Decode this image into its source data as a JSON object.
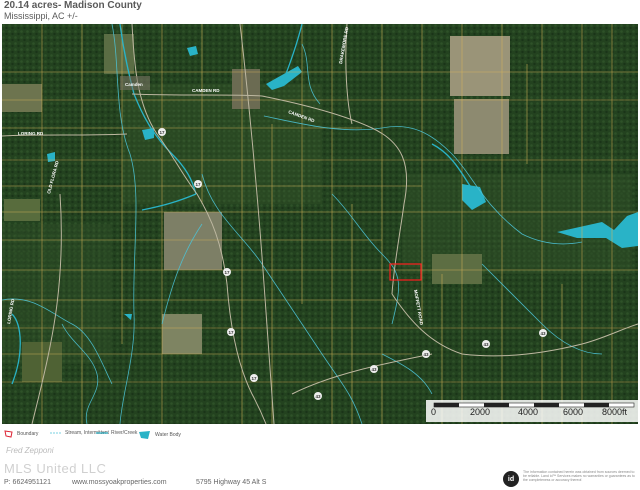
{
  "header": {
    "title": "20.14 acres- Madison County",
    "subtitle": "Mississippi, AC +/-"
  },
  "map": {
    "town_label": "Camden",
    "road_labels": [
      "CAMDEN RD",
      "LORING RD",
      "CAMDEN RD",
      "OLD FLORA RD",
      "DRAKEMORE RD",
      "LORING RD",
      "MOFFETT ROAD"
    ],
    "highway_shields": [
      "17",
      "17",
      "17",
      "17",
      "17",
      "43",
      "43",
      "43",
      "43",
      "43"
    ],
    "scale_ticks": [
      "0",
      "2000",
      "4000",
      "6000",
      "8000ft"
    ],
    "colors": {
      "boundary": "#ff2020",
      "parcel_lines": "#d9b65a",
      "water": "#29b3c7",
      "streams": "#4cc3d6",
      "forest": "#1f3d1f",
      "field": "#7a7f5e"
    }
  },
  "legend": {
    "items": [
      {
        "label": "Boundary",
        "icon": "boundary-icon"
      },
      {
        "label": "Stream, Intermittent",
        "icon": "stream-icon"
      },
      {
        "label": "River/Creek",
        "icon": "river-icon"
      },
      {
        "label": "Water Body",
        "icon": "water-body-icon"
      }
    ]
  },
  "footer": {
    "agent": "Fred Zepponi",
    "brokerage": "MLS United LLC",
    "phone": "P: 6624951121",
    "website": "www.mossyoakproperties.com",
    "address": "5795 Highway 45 Alt S",
    "logo": "id",
    "disclaimer": "The information contained herein was obtained from sources deemed to be reliable. Land id™ Services makes no warranties or guarantees as to the completeness or accuracy thereof."
  }
}
